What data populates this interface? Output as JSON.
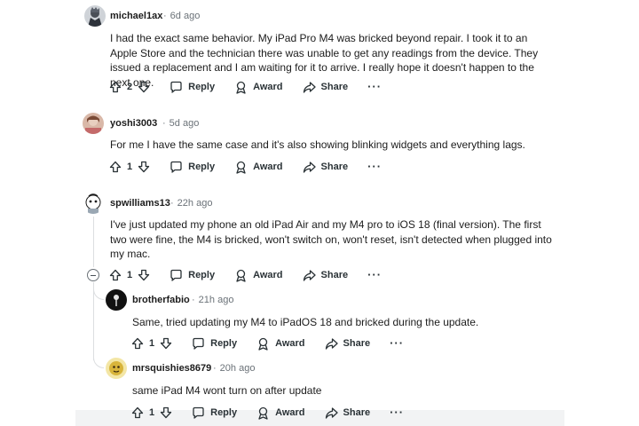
{
  "comments": [
    {
      "username": "michael1ax",
      "time": "6d ago",
      "body": "I had the exact same behavior. My iPad Pro M4 was bricked beyond repair. I took it to an Apple Store and the technician there was unable to get any readings from the device. They issued a replacement and I am waiting for it to arrive. I really hope it doesn't happen to the next one.",
      "votes": "2",
      "reply_label": "Reply",
      "award_label": "Award",
      "share_label": "Share",
      "more_label": "···"
    },
    {
      "username": "yoshi3003",
      "time": "5d ago",
      "body": "For me I have the same case and it's also showing blinking widgets and everything lags.",
      "votes": "1",
      "reply_label": "Reply",
      "award_label": "Award",
      "share_label": "Share",
      "more_label": "···"
    },
    {
      "username": "spwilliams13",
      "time": "22h ago",
      "body": "I've just updated my phone an old iPad Air and my M4 pro to iOS 18 (final version). The first two were fine, the M4 is bricked, won't switch on, won't reset, isn't detected when plugged into my mac.",
      "votes": "1",
      "reply_label": "Reply",
      "award_label": "Award",
      "share_label": "Share",
      "more_label": "···"
    },
    {
      "username": "brotherfabio",
      "time": "21h ago",
      "body": "Same, tried updating my M4 to iPadOS 18 and bricked during the update.",
      "votes": "1",
      "reply_label": "Reply",
      "award_label": "Award",
      "share_label": "Share",
      "more_label": "···"
    },
    {
      "username": "mrsquishies8679",
      "time": "20h ago",
      "body": "same iPad M4 wont turn on after update",
      "votes": "1",
      "reply_label": "Reply",
      "award_label": "Award",
      "share_label": "Share",
      "more_label": "···"
    }
  ],
  "meta_separator": "·",
  "icons": {
    "upvote": "upvote-arrow-icon",
    "downvote": "downvote-arrow-icon",
    "reply": "speech-bubble-icon",
    "award": "award-ribbon-icon",
    "share": "share-arrow-icon",
    "collapse": "collapse-minus-icon"
  }
}
